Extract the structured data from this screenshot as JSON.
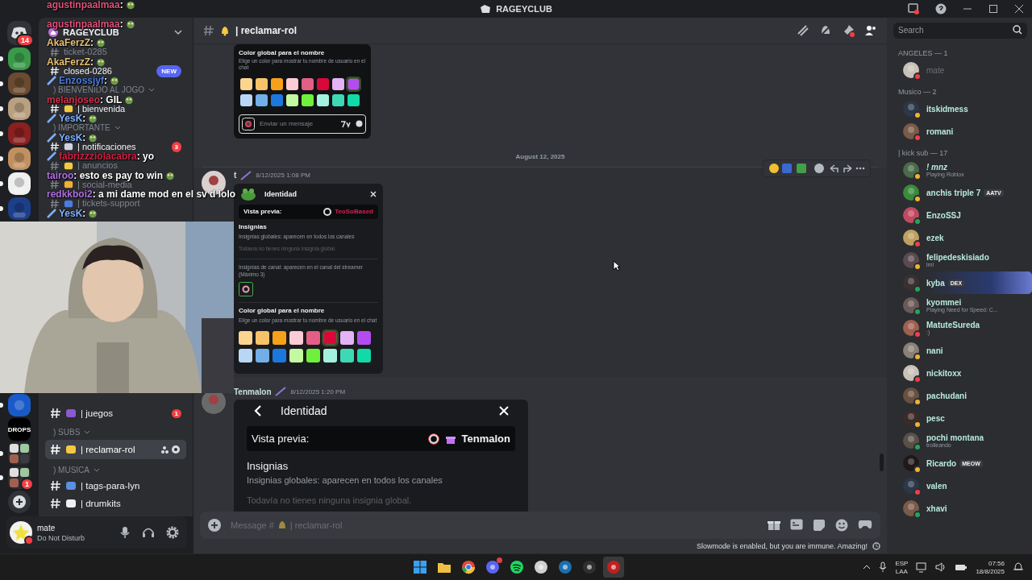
{
  "title_bar": {
    "title": "RAGEYCLUB"
  },
  "server_rail": {
    "home_badge": "14",
    "servers": [
      {
        "kind": "picture",
        "color": "#3a9a4a",
        "unread": true
      },
      {
        "kind": "picture",
        "color": "#6a4a30",
        "unread": true
      },
      {
        "kind": "picture",
        "color": "#b8a080",
        "unread": true
      },
      {
        "kind": "picture",
        "color": "#8a2020",
        "unread": true
      },
      {
        "kind": "picture",
        "color": "#c09060",
        "unread": true
      },
      {
        "kind": "picture",
        "color": "#f0f0f0",
        "unread": true
      },
      {
        "kind": "picture",
        "color": "#1d3f8a",
        "unread": true
      }
    ],
    "servers_lower": [
      {
        "kind": "picture",
        "color": "#1a5ac8",
        "unread": true
      },
      {
        "kind": "logo",
        "label": "DROPS",
        "unread": false
      },
      {
        "kind": "folder",
        "unread": true
      },
      {
        "kind": "folder",
        "unread": true,
        "badge": "1"
      }
    ]
  },
  "sidebar": {
    "server_name": "RAGEYCLUB",
    "items": [
      {
        "kind": "channel",
        "name": "ticket-0285",
        "unread": false,
        "selected": false
      },
      {
        "kind": "channel",
        "name": "closed-0286",
        "unread": true,
        "selected": false,
        "tag": "NEW"
      },
      {
        "kind": "category",
        "name": ") BIENVENIDO AL JOGO"
      },
      {
        "kind": "channel",
        "name": "| bienvenida",
        "unread": true,
        "selected": false,
        "color": "#f5c842"
      },
      {
        "kind": "category",
        "name": ") IMPORTANTE"
      },
      {
        "kind": "channel",
        "name": "| notificaciones",
        "unread": true,
        "selected": false,
        "color": "#d0d4e0",
        "badge": "3"
      },
      {
        "kind": "channel",
        "name": "| anuncios",
        "unread": false,
        "selected": false,
        "color": "#f5c842"
      },
      {
        "kind": "channel",
        "name": "| social-media",
        "unread": false,
        "selected": false,
        "color": "#f0b030"
      },
      {
        "kind": "channel",
        "name": "| tickets-support",
        "unread": false,
        "selected": false,
        "color": "#4a7be0"
      }
    ],
    "items_lower": [
      {
        "kind": "channel",
        "name": "| juegos",
        "unread": true,
        "selected": false,
        "color": "#8a5ad0",
        "badge": "1"
      },
      {
        "kind": "category",
        "name": ") SUBS"
      },
      {
        "kind": "channel",
        "name": "| reclamar-rol",
        "unread": true,
        "selected": true,
        "color": "#f5c842"
      },
      {
        "kind": "category",
        "name": ") MUSICA"
      },
      {
        "kind": "channel",
        "name": "| tags-para-lyn",
        "unread": true,
        "selected": false,
        "color": "#5a90e0"
      },
      {
        "kind": "channel",
        "name": "| drumkits",
        "unread": true,
        "selected": false,
        "color": "#f0f0f0"
      }
    ],
    "user": {
      "name": "mate",
      "status_text": "Do Not Disturb",
      "color": "#f23f43"
    }
  },
  "stream_overlay": {
    "chat": [
      {
        "user": "agustinpaalmaa",
        "color": "#e0507a",
        "text": ":",
        "emote": true,
        "badge": false
      },
      {
        "user": "agustinpaalmaa",
        "color": "#e0507a",
        "text": ":",
        "emote": true,
        "badge": false
      },
      {
        "user": "AkaFerzZ",
        "color": "#e8c070",
        "text": ":",
        "emote": true,
        "badge": false
      },
      {
        "user": "AkaFerzZ",
        "color": "#e8c070",
        "text": ":",
        "emote": true,
        "badge": false
      },
      {
        "user": "Enzossjyf",
        "color": "#4a7be0",
        "text": ":",
        "emote": true,
        "badge": true
      },
      {
        "user": "melanjoseo",
        "color": "#d0304a",
        "text": ": GIL",
        "emote": true,
        "badge": false
      },
      {
        "user": "YesK",
        "color": "#7fb0ff",
        "text": ":",
        "emote": true,
        "badge": true
      },
      {
        "user": "YesK",
        "color": "#7fb0ff",
        "text": ":",
        "emote": true,
        "badge": true
      },
      {
        "user": "fabrizzziolacabra",
        "color": "#d02040",
        "text": ": yo",
        "emote": false,
        "badge": true
      },
      {
        "user": "tairoo",
        "color": "#b070e0",
        "text": ": esto es pay to win",
        "emote": true,
        "badge": false
      },
      {
        "user": "redkkboi2",
        "color": "#b070e0",
        "text": ": a mi dame mod en el sv d lolo",
        "emote": false,
        "badge": false
      },
      {
        "user": "YesK",
        "color": "#7fb0ff",
        "text": ":",
        "emote": true,
        "badge": true
      }
    ]
  },
  "channel_header": {
    "name": "| reclamar-rol"
  },
  "messages": [
    {
      "panel": {
        "kind": "colors",
        "title": "Color global para el nombre",
        "description": "Elige un color para mostrar tu nombre de usuario en el chat",
        "swatches": [
          {
            "color": "#fcd58f",
            "selected": false
          },
          {
            "color": "#f6c36a",
            "selected": false
          },
          {
            "color": "#f6a11a",
            "selected": false
          },
          {
            "color": "#fbcbd6",
            "selected": false
          },
          {
            "color": "#e35f85",
            "selected": false
          },
          {
            "color": "#d8093a",
            "selected": false
          },
          {
            "color": "#e3b3f6",
            "selected": false
          },
          {
            "color": "#b44df0",
            "selected": true
          },
          {
            "color": "#b9d7f5",
            "selected": false
          },
          {
            "color": "#72aee8",
            "selected": false
          },
          {
            "color": "#1d78dd",
            "selected": false
          },
          {
            "color": "#c3f9a0",
            "selected": false
          },
          {
            "color": "#6ef03c",
            "selected": false
          },
          {
            "color": "#a3f2e0",
            "selected": false
          },
          {
            "color": "#3fd8b5",
            "selected": false
          },
          {
            "color": "#12d9a8",
            "selected": false
          }
        ],
        "input_placeholder": "Enviar un mensaje"
      }
    },
    {
      "kind": "divider",
      "text": "August 12, 2025"
    },
    {
      "kind": "message",
      "author": "t",
      "timestamp": "8/12/2025 1:08 PM",
      "hovered": true,
      "panel": {
        "kind": "identity_small",
        "title": "Identidad",
        "preview_label": "Vista previa:",
        "preview_name": "TeoSoBased",
        "badges_title": "Insignias",
        "badges_global": "Insignias globales: aparecen en todos los canales",
        "badges_empty": "Todavía no tienes ninguna insignia global.",
        "badges_channel": "Insignias de canal: aparecen en el canal del streamer (Máximo 3)",
        "color_title": "Color global para el nombre",
        "color_description": "Elige un color para mostrar tu nombre de usuario en el chat",
        "swatches": [
          {
            "color": "#fcd58f",
            "selected": false
          },
          {
            "color": "#f6c36a",
            "selected": false
          },
          {
            "color": "#f6a11a",
            "selected": false
          },
          {
            "color": "#fbcbd6",
            "selected": false
          },
          {
            "color": "#e35f85",
            "selected": false
          },
          {
            "color": "#d8093a",
            "selected": true
          },
          {
            "color": "#e3b3f6",
            "selected": false
          },
          {
            "color": "#b44df0",
            "selected": false
          },
          {
            "color": "#b9d7f5",
            "selected": false
          },
          {
            "color": "#72aee8",
            "selected": false
          },
          {
            "color": "#1d78dd",
            "selected": false
          },
          {
            "color": "#c3f9a0",
            "selected": false
          },
          {
            "color": "#6ef03c",
            "selected": false
          },
          {
            "color": "#a3f2e0",
            "selected": false
          },
          {
            "color": "#3fd8b5",
            "selected": false
          },
          {
            "color": "#12d9a8",
            "selected": false
          }
        ]
      }
    },
    {
      "kind": "message",
      "author": "Tenmalon",
      "timestamp": "8/12/2025 1:20 PM",
      "hovered": false,
      "panel": {
        "kind": "identity_large",
        "title": "Identidad",
        "preview_label": "Vista previa:",
        "preview_name": "Tenmalon",
        "badges_title": "Insignias",
        "badges_global": "Insignias globales: aparecen en todos los canales",
        "badges_empty": "Todavía no tienes ninguna insignia global."
      }
    }
  ],
  "composer": {
    "placeholder": "Message #",
    "channel": "| reclamar-rol"
  },
  "notice": "Slowmode is enabled, but you are immune. Amazing!",
  "search": {
    "placeholder": "Search"
  },
  "member_groups": [
    {
      "title": "ANGELES — 1",
      "members": [
        {
          "name": "mate",
          "color": "#f23f43",
          "dim": true
        }
      ]
    },
    {
      "title": "Musico — 2",
      "members": [
        {
          "name": "itskidmess",
          "color": "#f0b232",
          "dim": false
        },
        {
          "name": "romani",
          "color": "#f23f43",
          "dim": false
        }
      ]
    },
    {
      "title": "| kick sub — 17",
      "members": [
        {
          "name": "! mnz",
          "color": "#f0b232",
          "dim": false,
          "activity": "Playing Roblox"
        },
        {
          "name": "anchis triple 7",
          "color": "#f0b232",
          "dim": false,
          "tag": "AATV"
        },
        {
          "name": "EnzoSSJ",
          "color": "#23a55a",
          "dim": false
        },
        {
          "name": "ezek",
          "color": "#f23f43",
          "dim": false
        },
        {
          "name": "felipedeskisiado",
          "color": "#f0b232",
          "dim": false,
          "activity": "lml"
        },
        {
          "name": "kyba",
          "color": "#23a55a",
          "dim": false,
          "tag": "DEX",
          "banner": true
        },
        {
          "name": "kyommei",
          "color": "#23a55a",
          "dim": false,
          "activity": "Playing Need for Speed: C..."
        },
        {
          "name": "MatuteSureda",
          "color": "#f23f43",
          "dim": false,
          "activity": ":)"
        },
        {
          "name": "nani",
          "color": "#f0b232",
          "dim": false
        },
        {
          "name": "nickitoxx",
          "color": "#f23f43",
          "dim": false
        },
        {
          "name": "pachudani",
          "color": "#f0b232",
          "dim": false
        },
        {
          "name": "pesc",
          "color": "#f0b232",
          "dim": false
        },
        {
          "name": "pochi montana",
          "color": "#23a55a",
          "dim": false,
          "activity": "trolleando"
        },
        {
          "name": "Ricardo",
          "color": "#f0b232",
          "dim": false,
          "tag": "MEOW"
        },
        {
          "name": "valen",
          "color": "#f23f43",
          "dim": false
        },
        {
          "name": "xhavi",
          "color": "#23a55a",
          "dim": false
        }
      ]
    }
  ],
  "taskbar": {
    "apps": [
      {
        "kind": "windows",
        "active": false
      },
      {
        "kind": "files",
        "active": false
      },
      {
        "kind": "chrome",
        "active": false
      },
      {
        "kind": "discord",
        "active": false,
        "notification": true
      },
      {
        "kind": "spotify",
        "active": false
      },
      {
        "kind": "obs",
        "active": false
      },
      {
        "kind": "steam",
        "active": false
      },
      {
        "kind": "terminal",
        "active": false
      },
      {
        "kind": "app",
        "active": true
      }
    ],
    "language": "ESP",
    "layout": "LAA",
    "time": "07:56",
    "date": "18/8/2025"
  }
}
